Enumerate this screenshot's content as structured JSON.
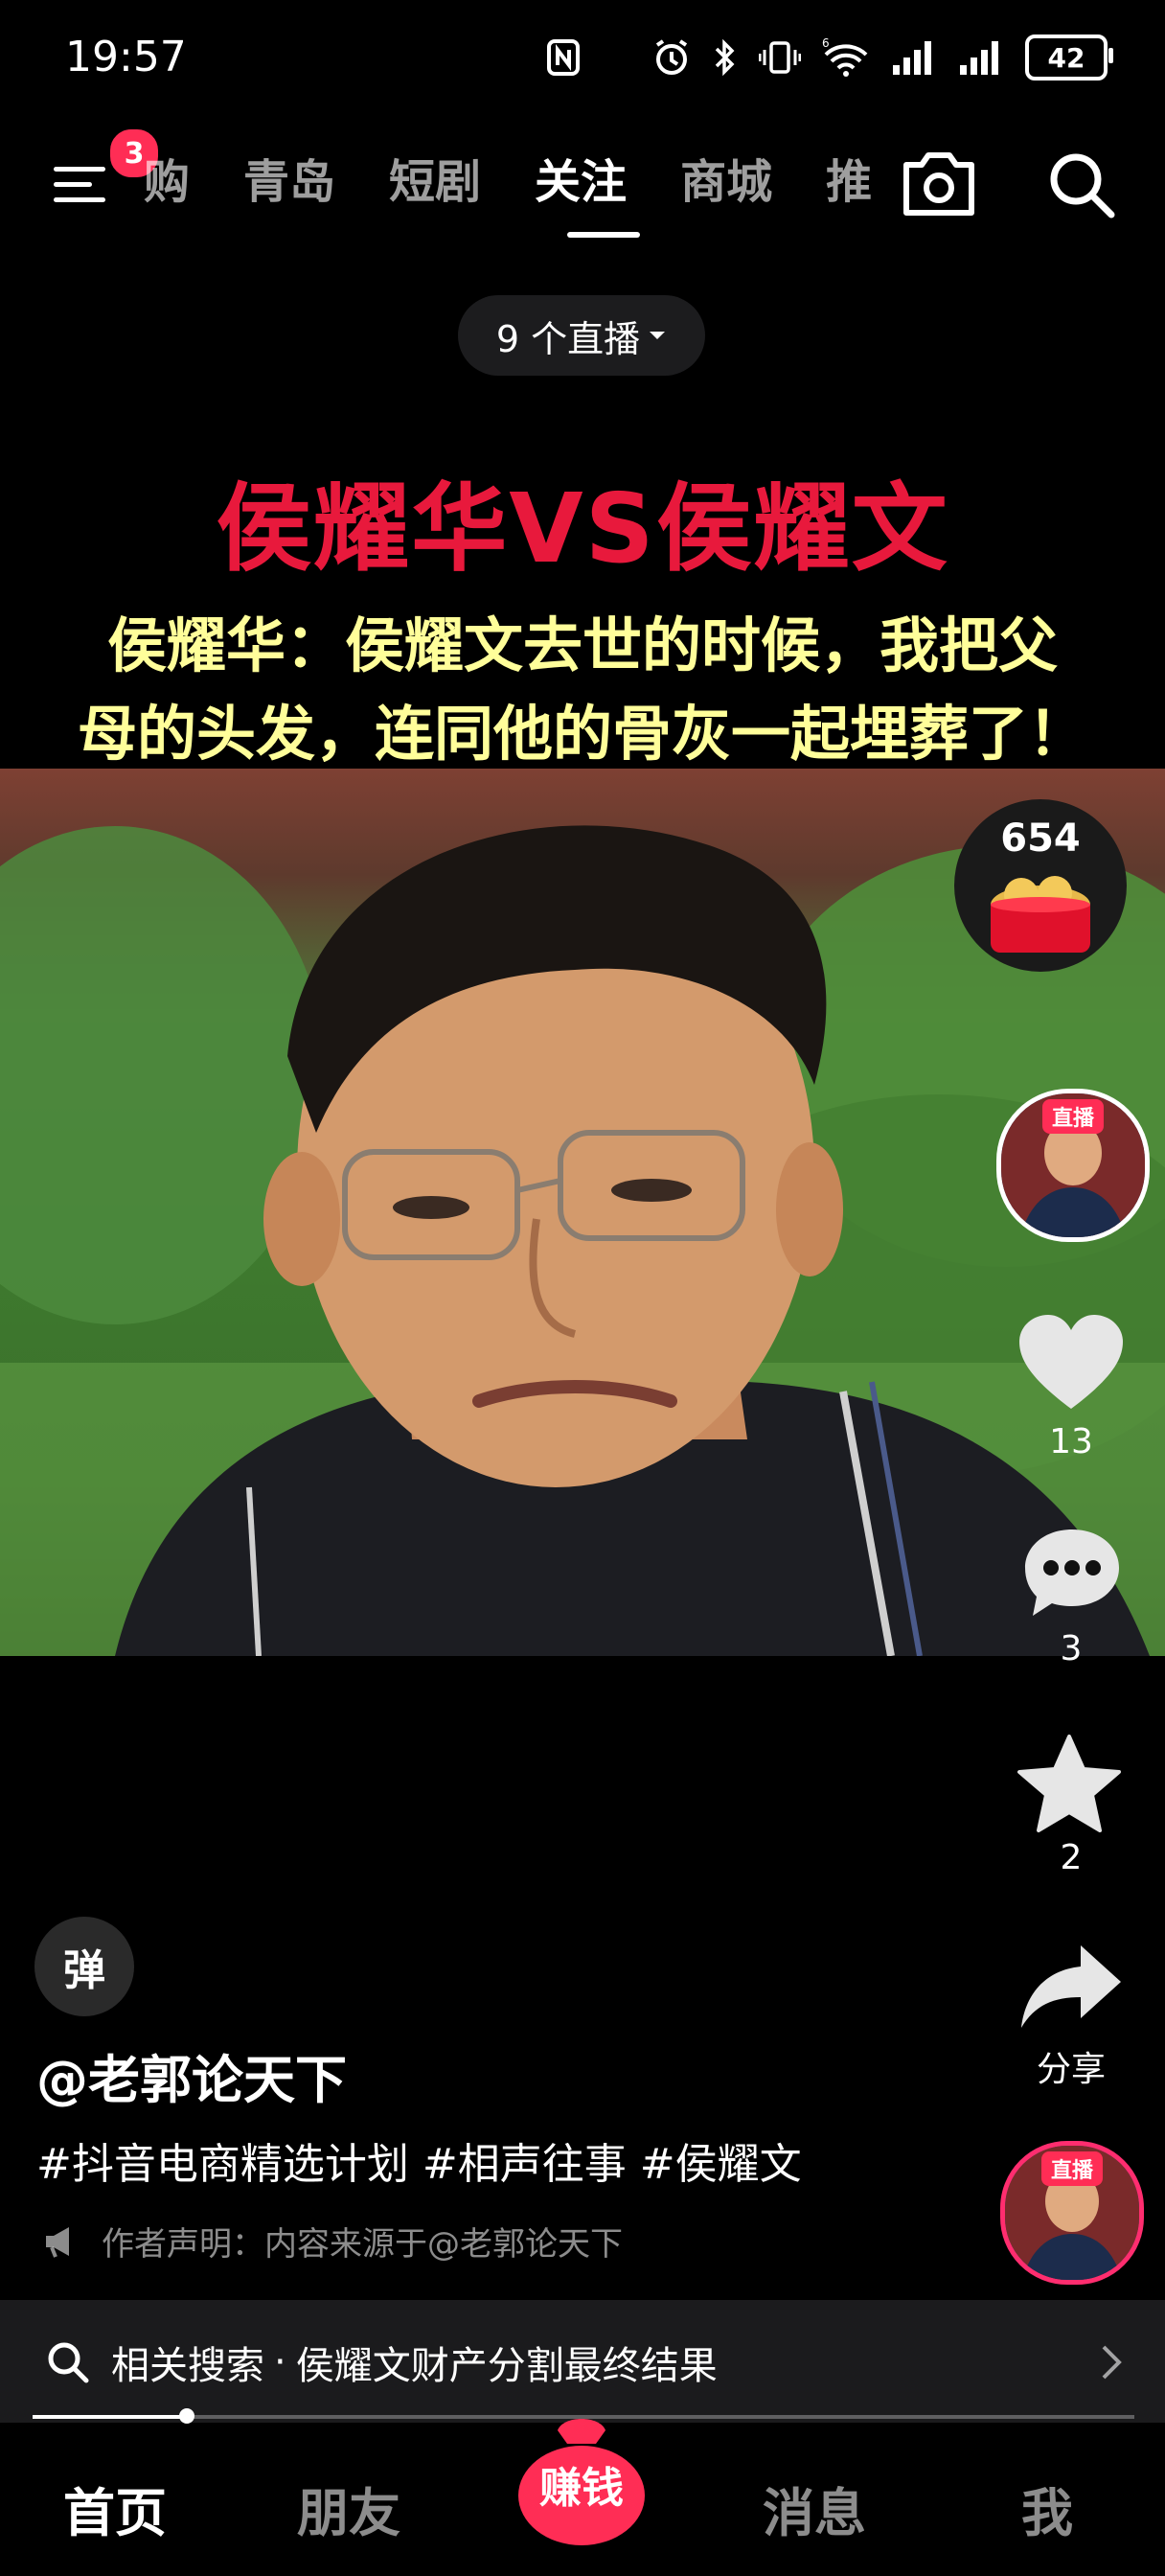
{
  "status": {
    "time": "19:57",
    "battery": "42"
  },
  "nav": {
    "badge": "3",
    "tabs": [
      "购",
      "青岛",
      "短剧",
      "关注",
      "商城",
      "推"
    ],
    "active_tab": "关注"
  },
  "live_pill": {
    "label": "9 个直播"
  },
  "video": {
    "title": "侯耀华VS侯耀文",
    "subtitle_line1": "侯耀华：侯耀文去世的时候，我把父",
    "subtitle_line2": "母的头发，连同他的骨灰一起埋葬了！"
  },
  "rail": {
    "redpack_count": "654",
    "live_tag": "直播",
    "likes": "13",
    "comments": "3",
    "favorites": "2",
    "share_label": "分享"
  },
  "post": {
    "danmu_label": "弹",
    "author": "@老郭论天下",
    "hashtags": "#抖音电商精选计划 #相声往事 #侯耀文",
    "declaration": "作者声明：内容来源于@老郭论天下"
  },
  "related_search": {
    "prefix": "相关搜索",
    "dot": "·",
    "query": "侯耀文财产分割最终结果"
  },
  "progress": {
    "fraction": 0.14
  },
  "bottom_nav": {
    "home": "首页",
    "friends": "朋友",
    "earn": "赚钱",
    "messages": "消息",
    "me": "我"
  },
  "colors": {
    "title_red": "#e8193c",
    "subtitle_yellow": "#fffe9a",
    "badge_red": "#ff2d55"
  }
}
